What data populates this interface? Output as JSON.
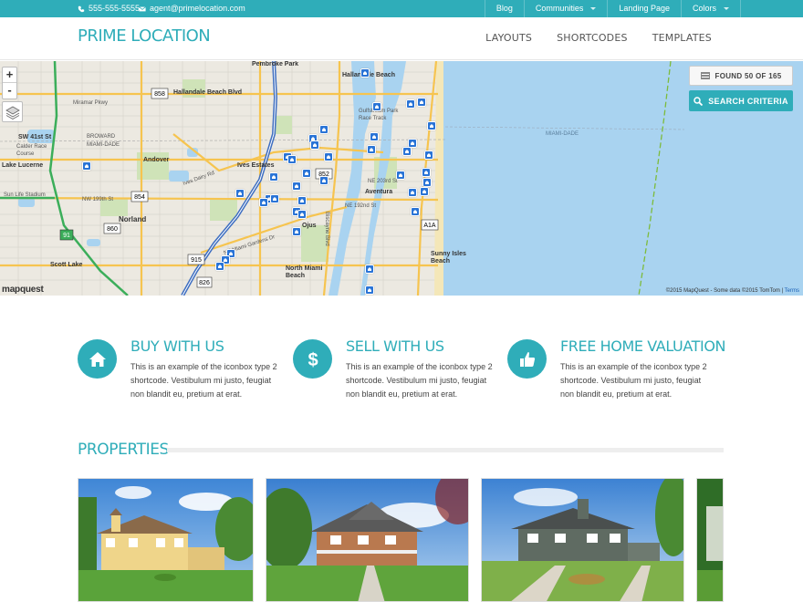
{
  "topbar": {
    "phone": "555-555-5555",
    "email": "agent@primelocation.com",
    "nav": [
      {
        "label": "Blog",
        "dropdown": false
      },
      {
        "label": "Communities",
        "dropdown": true
      },
      {
        "label": "Landing Page",
        "dropdown": false
      },
      {
        "label": "Colors",
        "dropdown": true
      }
    ]
  },
  "header": {
    "logo": "PRIME LOCATION",
    "nav": [
      "LAYOUTS",
      "SHORTCODES",
      "TEMPLATES"
    ]
  },
  "map": {
    "zoom_in": "+",
    "zoom_out": "-",
    "found_label": "FOUND 50 OF 165",
    "search_label": "SEARCH CRITERIA",
    "provider": "mapquest",
    "copyright": "©2015 MapQuest - Some data ©2015 TomTom |",
    "terms": "Terms",
    "labels": {
      "pembroke_park": "Pembroke Park",
      "hallandale_beach": "Hallandale Beach",
      "hallandale_blvd": "Hallandale Beach Blvd",
      "miramar_pkwy": "Miramar Pkwy",
      "broward": "BROWARD",
      "miami_dade": "MIAMI-DADE",
      "miami_dade_sea": "MIAMI-DADE",
      "gulfstream": "Gulfstream Park Race Track",
      "calder": "Calder Race Course",
      "sw41": "SW 41st St",
      "lake_lucerne": "Lake Lucerne",
      "andover": "Andover",
      "ives_estates": "Ives Estates",
      "ives_dairy": "Ives Dairy Rd",
      "ne_203": "NE 203rd St",
      "aventura": "Aventura",
      "ne_192": "NE 192nd St",
      "sun_life": "Sun Life Stadium",
      "nw_199": "NW 199th St",
      "norland": "Norland",
      "ojus": "Ojus",
      "biscayne": "Biscayne Blvd",
      "ne_miami_gardens": "NE Miami Gardens Dr",
      "sunny_isles": "Sunny Isles Beach",
      "scott_lake": "Scott Lake",
      "north_miami_beach": "North Miami Beach",
      "shield_858": "858",
      "shield_854": "854",
      "shield_852": "852",
      "shield_860": "860",
      "shield_91": "91",
      "shield_915": "915",
      "shield_a1a": "A1A",
      "shield_826": "826"
    }
  },
  "features": [
    {
      "title": "BUY WITH US",
      "text": "This is an example of the iconbox type 2 shortcode. Vestibulum mi justo, feugiat non blandit eu, pretium at erat.",
      "icon": "home-icon"
    },
    {
      "title": "SELL WITH US",
      "text": "This is an example of the iconbox type 2 shortcode. Vestibulum mi justo, feugiat non blandit eu, pretium at erat.",
      "icon": "dollar-icon"
    },
    {
      "title": "FREE HOME VALUATION",
      "text": "This is an example of the iconbox type 2 shortcode. Vestibulum mi justo, feugiat non blandit eu, pretium at erat.",
      "icon": "thumbs-up-icon"
    }
  ],
  "properties": {
    "title": "PROPERTIES"
  },
  "colors": {
    "accent": "#2fadb9",
    "water": "#a9d3f0",
    "pin": "#2a74d6"
  }
}
